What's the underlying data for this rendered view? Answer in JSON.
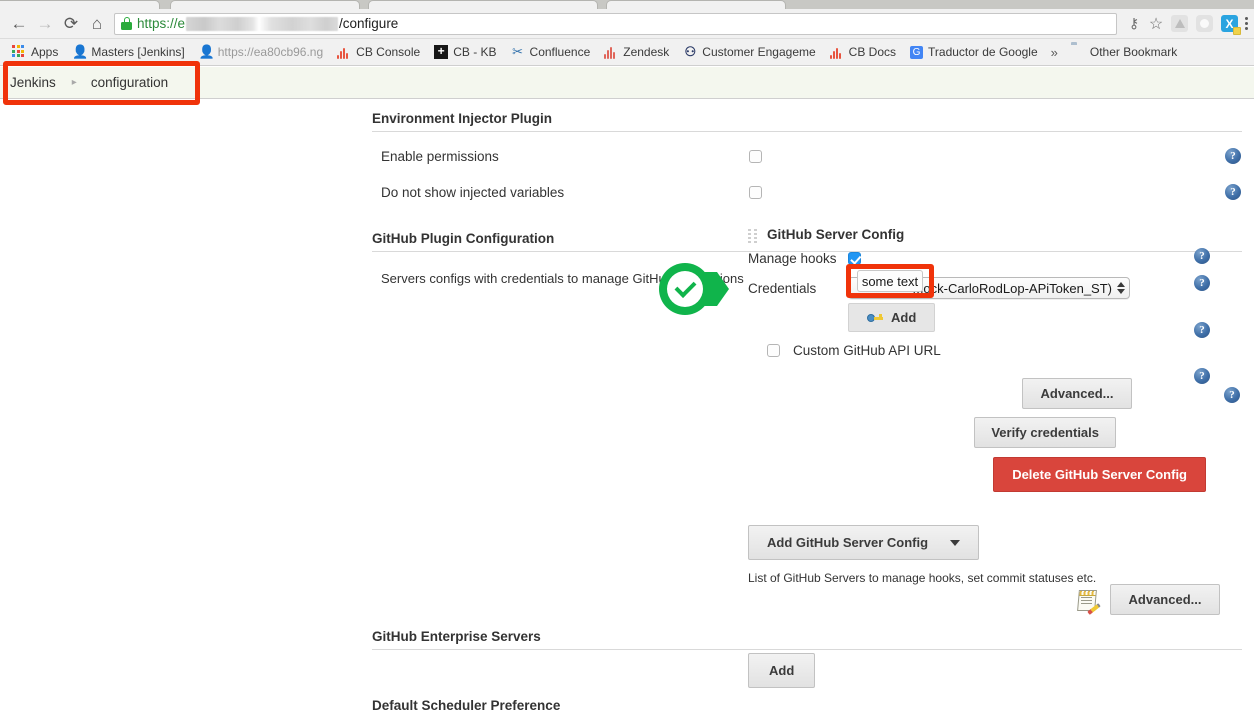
{
  "browser": {
    "nav": {
      "back": "←",
      "forward": "→",
      "reload": "⟳",
      "home": "⌂"
    },
    "omnibox": {
      "lock_icon": "lock-icon",
      "url_protocol": "https://e",
      "url_redacted": "",
      "url_path": "/configure"
    },
    "toolbar_icons": {
      "key": "⚷",
      "star": "☆",
      "drive": "drive-extension-icon",
      "pocket": "pocket-extension-icon",
      "x_extension": "X",
      "menu": "menu-icon"
    },
    "bookmarks": [
      {
        "label": "Apps",
        "icon": "apps-grid-icon",
        "faded": false
      },
      {
        "label": "Masters [Jenkins]",
        "icon": "jenkins-icon",
        "faded": false
      },
      {
        "label": "https://ea80cb96.ng",
        "icon": "jenkins-icon",
        "faded": true
      },
      {
        "label": "CB Console",
        "icon": "cb-bars-icon",
        "faded": false
      },
      {
        "label": "CB - KB",
        "icon": "plus-square-icon",
        "faded": false
      },
      {
        "label": "Confluence",
        "icon": "confluence-icon",
        "faded": false
      },
      {
        "label": "Zendesk",
        "icon": "zendesk-icon",
        "faded": false
      },
      {
        "label": "Customer Engageme",
        "icon": "customer-engagement-icon",
        "faded": false
      },
      {
        "label": "CB Docs",
        "icon": "cb-bars-icon",
        "faded": false
      },
      {
        "label": "Traductor de Google",
        "icon": "google-translate-icon",
        "faded": false
      }
    ],
    "bookmarks_overflow": "»",
    "other_bookmarks": {
      "label": "Other Bookmark",
      "icon": "folder-icon"
    }
  },
  "breadcrumb": {
    "root": "Jenkins",
    "separator": "▸",
    "current": "configuration"
  },
  "sections": {
    "env_injector": {
      "title": "Environment Injector Plugin",
      "rows": [
        {
          "label": "Enable permissions",
          "checked": false
        },
        {
          "label": "Do not show injected variables",
          "checked": false
        }
      ]
    },
    "github_plugin": {
      "title": "GitHub Plugin Configuration",
      "description": "Servers configs with credentials to manage GitHub integrations",
      "server_config": {
        "title": "GitHub Server Config",
        "manage_hooks_label": "Manage hooks",
        "manage_hooks_checked": true,
        "credentials_label": "Credentials",
        "credentials_value": "Mock-CarloRodLop-APiToken_ST)",
        "add_credentials_label": "Add",
        "add_credentials_icon": "key-icon",
        "custom_api_url_label": "Custom GitHub API URL",
        "custom_api_url_checked": false,
        "advanced_label": "Advanced...",
        "verify_label": "Verify credentials",
        "delete_label": "Delete GitHub Server Config"
      },
      "add_server_config_label": "Add GitHub Server Config",
      "add_server_config_caret": "caret-down-icon",
      "list_hint": "List of GitHub Servers to manage hooks, set commit statuses etc.",
      "advanced_label": "Advanced...",
      "advanced_icon": "notepad-pencil-icon"
    },
    "github_enterprise": {
      "title": "GitHub Enterprise Servers",
      "add_label": "Add"
    },
    "scheduler": {
      "title": "Default Scheduler Preference"
    }
  },
  "annotations": {
    "breadcrumb_highlight": "red-rectangle",
    "credentials_highlight": "red-rectangle",
    "credentials_overlay_text": "some text",
    "success_marker": "green-check-badge"
  },
  "help_icon": "?",
  "colors": {
    "annotation_red": "#f0330a",
    "success_green": "#10b44b",
    "danger_red": "#d9453c",
    "checkbox_blue": "#2196f3",
    "breadcrumb_bg": "#f4f7ee"
  }
}
